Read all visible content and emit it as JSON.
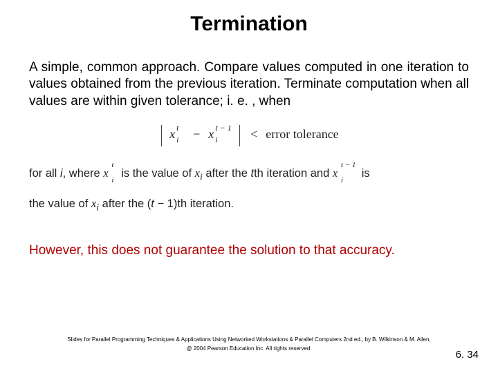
{
  "title": "Termination",
  "paragraph": "A simple, common approach. Compare values computed in one iteration to values obtained from the previous iteration. Terminate computation when all values are within given tolerance; i. e. , when",
  "formula": {
    "var": "x",
    "sub": "i",
    "sup1": "t",
    "sup2": "t − 1",
    "op": "−",
    "cmp": "<",
    "rhs": "error tolerance"
  },
  "explain": {
    "lead": "for all ",
    "i": "i",
    "comma_where": ", where ",
    "is_val": " is the value of ",
    "xi_var": "x",
    "xi_sub": "i",
    "after_the": " after the ",
    "tth": "t",
    "th_iter_and": "th iteration and ",
    "is_end": " is",
    "line2_lead": "the value of ",
    "after_the2": " after the (",
    "t_minus": "t",
    "minus_sym": " − ",
    "one": "1",
    "close": ")th iteration."
  },
  "conclusion": "However, this does not guarantee the solution to that accuracy.",
  "footer_line1": "Slides for Parallel Programming Techniques & Applications Using Networked Workstations & Parallel Computers 2nd ed., by B. Wilkinson & M. Allen,",
  "footer_line2": "@ 2004 Pearson Education Inc. All rights reserved.",
  "page": "6. 34"
}
